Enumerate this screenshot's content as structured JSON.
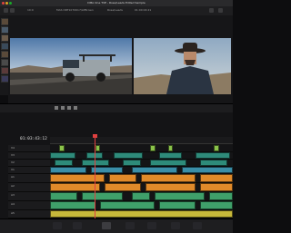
{
  "app": {
    "title": "DMA One TVE - Rosa/Leads Edited Sample"
  },
  "toolbar": {
    "left_text": "10:0 ",
    "source_clip": "MAS DRT1070617/LPBrown",
    "timeline_name": "Rosa/Leads",
    "timecode_in": "00:00:03:15",
    "zoom": "37%",
    "timeline_timecode": "01:00:04:21"
  },
  "timeline": {
    "timecode": "01:03:43:12",
    "tracks": [
      {
        "id": "V4",
        "clips_color": "#8bc34a"
      },
      {
        "id": "V3",
        "clips_color": "#2e8b7a"
      },
      {
        "id": "V2",
        "clips_color": "#2e8b7a"
      },
      {
        "id": "V1",
        "clips_color": "#3a8ea8"
      },
      {
        "id": "A1",
        "clips_color": "#e08a2a"
      },
      {
        "id": "A2",
        "clips_color": "#e08a2a"
      },
      {
        "id": "A3",
        "clips_color": "#3fa06a"
      },
      {
        "id": "A4",
        "clips_color": "#3fa06a"
      },
      {
        "id": "A5",
        "clips_color": "#c7b83a"
      }
    ]
  },
  "pages": [
    {
      "name": "media",
      "icon": "media-icon"
    },
    {
      "name": "cut",
      "icon": "cut-icon"
    },
    {
      "name": "edit",
      "icon": "edit-icon",
      "active": true
    },
    {
      "name": "fusion",
      "icon": "fusion-icon"
    },
    {
      "name": "color",
      "icon": "color-icon"
    },
    {
      "name": "fairlight",
      "icon": "fairlight-icon"
    },
    {
      "name": "deliver",
      "icon": "deliver-icon"
    }
  ],
  "colors": {
    "accent": "#e04040",
    "video": "#3a8ea8",
    "audio": "#e08a2a",
    "green": "#3fa06a",
    "lime": "#8bc34a"
  }
}
